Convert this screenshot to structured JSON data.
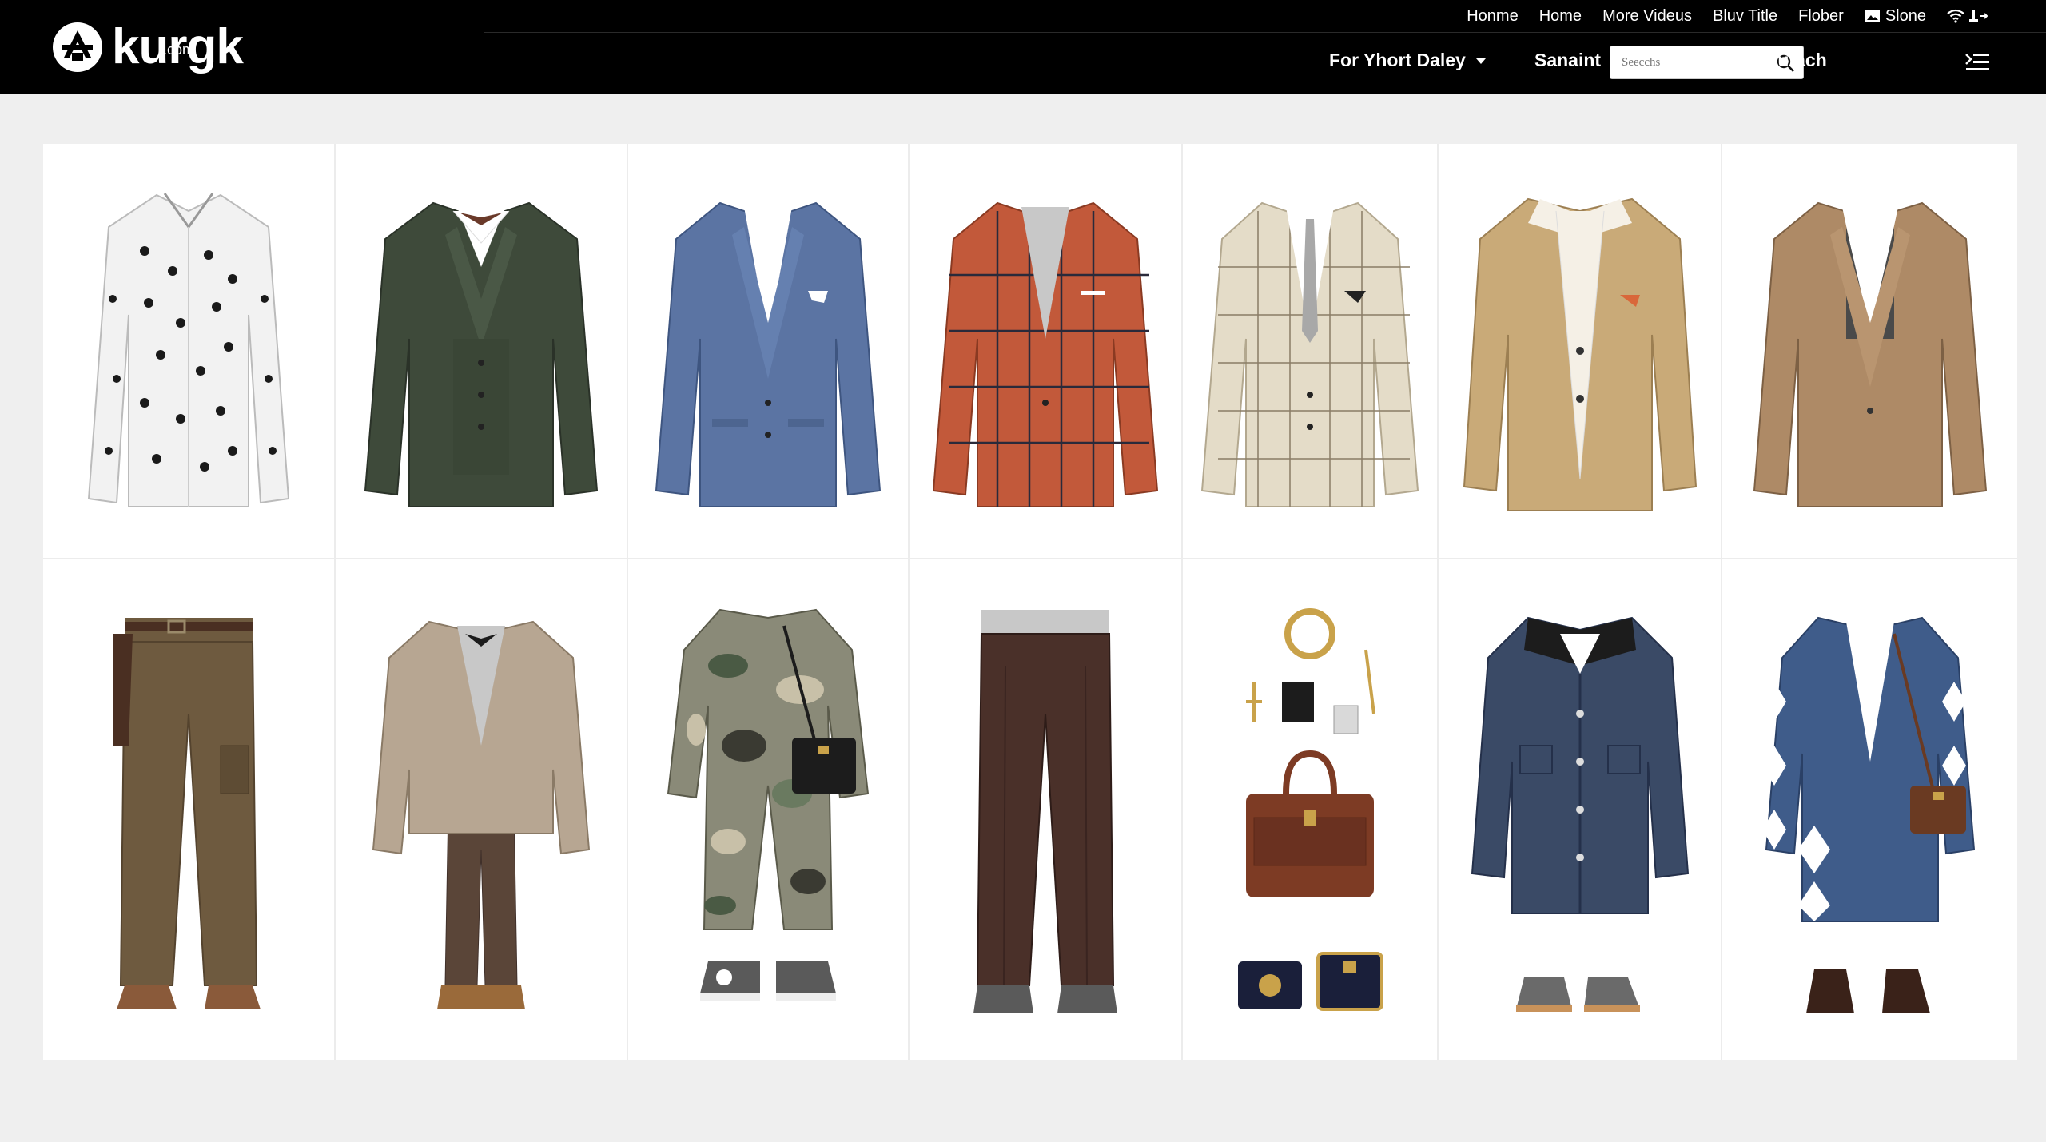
{
  "site": {
    "logo_text": "kurgk",
    "logo_sub": ".com"
  },
  "topnav": {
    "links": [
      "Honme",
      "Home",
      "More Videus",
      "Bluv Title",
      "Flober"
    ],
    "slone_label": "Slone"
  },
  "mainnav": {
    "dropdown_label": "For Yhort Daley",
    "link_sanaint": "Sanaint",
    "link_cautach": "Cautach",
    "search_placeholder": "Seecchs"
  },
  "colors": {
    "header_bg": "#000000",
    "page_bg": "#efefef",
    "card_bg": "#ffffff"
  },
  "products": [
    {
      "id": "polka-dot-shirt",
      "icon": "shirt-icon",
      "color": "#f2f2f2",
      "accent": "#1a1a1a"
    },
    {
      "id": "green-three-piece-suit",
      "icon": "blazer-icon",
      "color": "#3e4a3a",
      "accent": "#ffffff"
    },
    {
      "id": "blue-blazer",
      "icon": "blazer-icon",
      "color": "#5b74a3",
      "accent": "#ffffff"
    },
    {
      "id": "rust-plaid-blazer",
      "icon": "blazer-icon",
      "color": "#c2593a",
      "accent": "#2a2a3a"
    },
    {
      "id": "cream-check-blazer",
      "icon": "blazer-icon",
      "color": "#e4dcc8",
      "accent": "#8a7d66"
    },
    {
      "id": "camel-overcoat",
      "icon": "coat-icon",
      "color": "#c9aa78",
      "accent": "#f5f0e6"
    },
    {
      "id": "tan-blazer",
      "icon": "blazer-icon",
      "color": "#ae8a66",
      "accent": "#4a4a4a"
    },
    {
      "id": "brown-cargo-pants",
      "icon": "pants-icon",
      "color": "#6e5a3f",
      "accent": "#4a2f22"
    },
    {
      "id": "beige-coat-outfit",
      "icon": "coat-icon",
      "color": "#b7a692",
      "accent": "#5a4538"
    },
    {
      "id": "camo-jumpsuit",
      "icon": "jumpsuit-icon",
      "color": "#8a8a78",
      "accent": "#1c1c1c"
    },
    {
      "id": "brown-trousers",
      "icon": "pants-icon",
      "color": "#4a3029",
      "accent": "#c8c8c8"
    },
    {
      "id": "leather-accessories",
      "icon": "bag-icon",
      "color": "#7d3b24",
      "accent": "#c9a24a"
    },
    {
      "id": "navy-chore-jacket",
      "icon": "coat-icon",
      "color": "#3a4a66",
      "accent": "#1c1c1c"
    },
    {
      "id": "argyle-blazer-outfit",
      "icon": "blazer-icon",
      "color": "#3f5c8a",
      "accent": "#6a3a22"
    }
  ]
}
